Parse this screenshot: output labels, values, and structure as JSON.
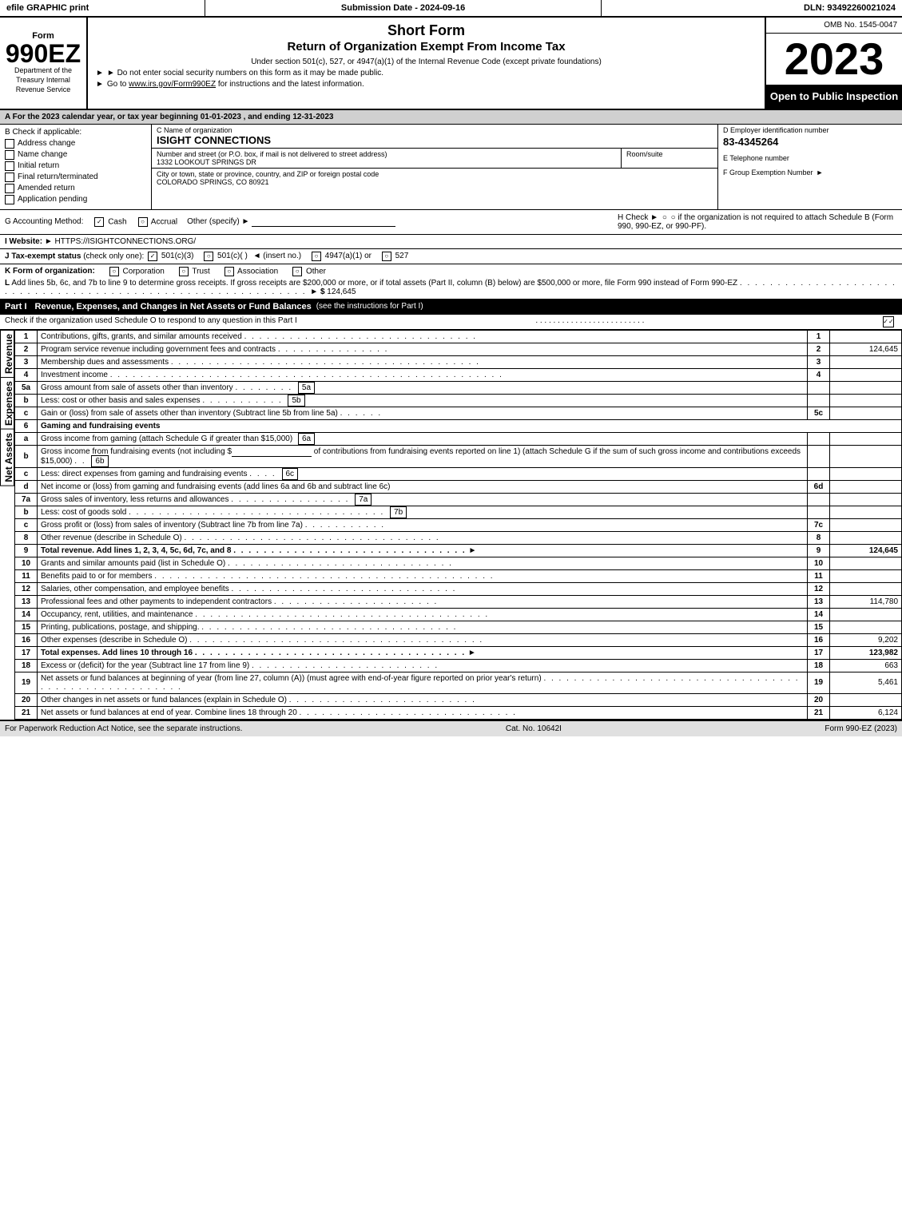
{
  "header": {
    "left": "efile GRAPHIC print",
    "mid": "Submission Date - 2024-09-16",
    "right": "DLN: 93492260021024"
  },
  "form": {
    "number": "990EZ",
    "sub": "Department of the Treasury Internal Revenue Service",
    "short_form": "Short Form",
    "return_title": "Return of Organization Exempt From Income Tax",
    "note1": "Under section 501(c), 527, or 4947(a)(1) of the Internal Revenue Code (except private foundations)",
    "note2": "► Do not enter social security numbers on this form as it may be made public.",
    "note3": "► Go to www.irs.gov/Form990EZ for instructions and the latest information.",
    "omb": "OMB No. 1545-0047",
    "year": "2023",
    "open_public": "Open to Public Inspection"
  },
  "section_a": {
    "label": "A For the 2023 calendar year, or tax year beginning 01-01-2023 , and ending 12-31-2023"
  },
  "check_applicable": {
    "label": "B Check if applicable:",
    "items": [
      {
        "label": "Address change",
        "checked": false
      },
      {
        "label": "Name change",
        "checked": false
      },
      {
        "label": "Initial return",
        "checked": false
      },
      {
        "label": "Final return/terminated",
        "checked": false
      },
      {
        "label": "Amended return",
        "checked": false
      },
      {
        "label": "Application pending",
        "checked": false
      }
    ]
  },
  "org": {
    "name_label": "C Name of organization",
    "name": "ISIGHT CONNECTIONS",
    "address_label": "Number and street (or P.O. box, if mail is not delivered to street address)",
    "address": "1332 LOOKOUT SPRINGS DR",
    "room_label": "Room/suite",
    "room": "",
    "city_label": "City or town, state or province, country, and ZIP or foreign postal code",
    "city": "COLORADO SPRINGS, CO  80921",
    "ein_label": "D Employer identification number",
    "ein": "83-4345264",
    "phone_label": "E Telephone number",
    "phone": "",
    "group_label": "F Group Exemption Number",
    "group_arrow": "►"
  },
  "accounting": {
    "label": "G Accounting Method:",
    "cash_label": "Cash",
    "cash_checked": true,
    "accrual_label": "Accrual",
    "accrual_checked": false,
    "other_label": "Other (specify) ►",
    "other_line": "___________________________",
    "h_label": "H  Check ►",
    "h_text": "○  if the organization is not required to attach Schedule B (Form 990, 990-EZ, or 990-PF)."
  },
  "website": {
    "label": "I Website: ►",
    "url": "HTTPS://ISIGHTCONNECTIONS.ORG/"
  },
  "tax_exempt": {
    "label": "J Tax-exempt status",
    "note": "(check only one):",
    "options": [
      {
        "label": "501(c)(3)",
        "checked": true
      },
      {
        "label": "501(c)(  )",
        "checked": false
      },
      {
        "label": "(insert no.)",
        "checked": false
      },
      {
        "label": "4947(a)(1) or",
        "checked": false
      },
      {
        "label": "527",
        "checked": false
      }
    ]
  },
  "k_line": {
    "label": "K Form of organization:",
    "options": [
      {
        "label": "Corporation",
        "checked": false
      },
      {
        "label": "Trust",
        "checked": false
      },
      {
        "label": "Association",
        "checked": false
      },
      {
        "label": "Other",
        "checked": false
      }
    ]
  },
  "l_line": {
    "text": "L Add lines 5b, 6c, and 7b to line 9 to determine gross receipts. If gross receipts are $200,000 or more, or if total assets (Part II, column (B) below) are $500,000 or more, file Form 990 instead of Form 990-EZ",
    "dots": ". . . . . . . . . . . . . . . . . . . . . . . . . . . . . . . . . . . . . . . . . . . . . . . . . . . .",
    "arrow": "► $",
    "amount": "124,645"
  },
  "part1": {
    "label": "Part I",
    "title": "Revenue, Expenses, and Changes in Net Assets or Fund Balances",
    "note": "(see the instructions for Part I)",
    "check_note": "Check if the organization used Schedule O to respond to any question in this Part I",
    "dots": ". . . . . . . . . . . . . . . . . . . . . . . . .",
    "checkbox": true
  },
  "revenue_rows": [
    {
      "num": "1",
      "desc": "Contributions, gifts, grants, and similar amounts received",
      "dots": ". . . . . . . . . . . . . . . . . . . . . . . . . . . .",
      "col_label": "",
      "col_num": "1",
      "amount": ""
    },
    {
      "num": "2",
      "desc": "Program service revenue including government fees and contracts",
      "dots": ". . . . . . . . . . . . . . .",
      "col_label": "",
      "col_num": "2",
      "amount": "124,645"
    },
    {
      "num": "3",
      "desc": "Membership dues and assessments",
      "dots": ". . . . . . . . . . . . . . . . . . . . . . . . . . . . . . . . . . . . . . . .",
      "col_label": "",
      "col_num": "3",
      "amount": ""
    },
    {
      "num": "4",
      "desc": "Investment income",
      "dots": ". . . . . . . . . . . . . . . . . . . . . . . . . . . . . . . . . . . . . . . . . . . . . . . . . . .",
      "col_label": "",
      "col_num": "4",
      "amount": ""
    },
    {
      "num": "5a",
      "desc": "Gross amount from sale of assets other than inventory",
      "dots": ". . . . . . . .",
      "col_label": "5a",
      "col_num": "",
      "amount": ""
    },
    {
      "num": "b",
      "desc": "Less: cost or other basis and sales expenses",
      "dots": ". . . . . . . . . . .",
      "col_label": "5b",
      "col_num": "",
      "amount": ""
    },
    {
      "num": "c",
      "desc": "Gain or (loss) from sale of assets other than inventory (Subtract line 5b from line 5a)",
      "dots": ". . . . . .",
      "col_label": "",
      "col_num": "5c",
      "amount": ""
    },
    {
      "num": "6",
      "desc": "Gaming and fundraising events",
      "dots": "",
      "col_label": "",
      "col_num": "",
      "amount": ""
    },
    {
      "num": "a",
      "desc": "Gross income from gaming (attach Schedule G if greater than $15,000)",
      "dots": "",
      "col_label": "6a",
      "col_num": "",
      "amount": ""
    },
    {
      "num": "b",
      "desc_part1": "Gross income from fundraising events (not including $",
      "underline": "________________",
      "desc_part2": " of contributions from fundraising events reported on line 1) (attach Schedule G if the sum of such gross income and contributions exceeds $15,000)",
      "dots": ". .",
      "col_label": "6b",
      "col_num": "",
      "amount": ""
    },
    {
      "num": "c",
      "desc": "Less: direct expenses from gaming and fundraising events",
      "dots": ". . . .",
      "col_label": "6c",
      "col_num": "",
      "amount": ""
    },
    {
      "num": "d",
      "desc": "Net income or (loss) from gaming and fundraising events (add lines 6a and 6b and subtract line 6c)",
      "dots": "",
      "col_label": "",
      "col_num": "6d",
      "amount": ""
    },
    {
      "num": "7a",
      "desc": "Gross sales of inventory, less returns and allowances",
      "dots": ". . . . . . . . . . . . . . . .",
      "col_label": "7a",
      "col_num": "",
      "amount": ""
    },
    {
      "num": "b",
      "desc": "Less: cost of goods sold",
      "dots": ". . . . . . . . . . . . . . . . . . . . . . . . . . . . . . . . . . .",
      "col_label": "7b",
      "col_num": "",
      "amount": ""
    },
    {
      "num": "c",
      "desc": "Gross profit or (loss) from sales of inventory (Subtract line 7b from line 7a)",
      "dots": ". . . . . . . . . . .",
      "col_label": "",
      "col_num": "7c",
      "amount": ""
    },
    {
      "num": "8",
      "desc": "Other revenue (describe in Schedule O)",
      "dots": ". . . . . . . . . . . . . . . . . . . . . . . . . . . . . . . . . .",
      "col_label": "",
      "col_num": "8",
      "amount": ""
    },
    {
      "num": "9",
      "desc": "Total revenue. Add lines 1, 2, 3, 4, 5c, 6d, 7c, and 8",
      "dots": ". . . . . . . . . . . . . . . . . . . . . . . . . . . . . . .",
      "arrow": "►",
      "col_label": "",
      "col_num": "9",
      "amount": "124,645",
      "bold": true
    }
  ],
  "expenses_rows": [
    {
      "num": "10",
      "desc": "Grants and similar amounts paid (list in Schedule O)",
      "dots": ". . . . . . . . . . . . . . . . . . . . . . . . . . . . . .",
      "col_num": "10",
      "amount": ""
    },
    {
      "num": "11",
      "desc": "Benefits paid to or for members",
      "dots": ". . . . . . . . . . . . . . . . . . . . . . . . . . . . . . . . . . . . . . . . . . . . .",
      "col_num": "11",
      "amount": ""
    },
    {
      "num": "12",
      "desc": "Salaries, other compensation, and employee benefits",
      "dots": ". . . . . . . . . . . . . . . . . . . . . . . . . . . . . .",
      "col_num": "12",
      "amount": ""
    },
    {
      "num": "13",
      "desc": "Professional fees and other payments to independent contractors",
      "dots": ". . . . . . . . . . . . . . . . . . . . . .",
      "col_num": "13",
      "amount": "114,780"
    },
    {
      "num": "14",
      "desc": "Occupancy, rent, utilities, and maintenance",
      "dots": ". . . . . . . . . . . . . . . . . . . . . . . . . . . . . . . . . . . . . . .",
      "col_num": "14",
      "amount": ""
    },
    {
      "num": "15",
      "desc": "Printing, publications, postage, and shipping.",
      "dots": ". . . . . . . . . . . . . . . . . . . . . . . . . . . . . . . . . . .",
      "col_num": "15",
      "amount": ""
    },
    {
      "num": "16",
      "desc": "Other expenses (describe in Schedule O)",
      "dots": ". . . . . . . . . . . . . . . . . . . . . . . . . . . . . . . . . . . . . . .",
      "col_num": "16",
      "amount": "9,202"
    },
    {
      "num": "17",
      "desc": "Total expenses. Add lines 10 through 16",
      "dots": ". . . . . . . . . . . . . . . . . . . . . . . . . . . . . . . . . . . .",
      "arrow": "►",
      "col_num": "17",
      "amount": "123,982",
      "bold": true
    }
  ],
  "net_assets_rows": [
    {
      "num": "18",
      "desc": "Excess or (deficit) for the year (Subtract line 17 from line 9)",
      "dots": ". . . . . . . . . . . . . . . . . . . . . . . . .",
      "col_num": "18",
      "amount": "663"
    },
    {
      "num": "19",
      "desc": "Net assets or fund balances at beginning of year (from line 27, column (A)) (must agree with end-of-year figure reported on prior year's return)",
      "dots": ". . . . . . . . . . . . . . . . . . . . . . . . . . . . . . . . . . . . . . . . . . . . . . . . . . . . .",
      "col_num": "19",
      "amount": "5,461"
    },
    {
      "num": "20",
      "desc": "Other changes in net assets or fund balances (explain in Schedule O)",
      "dots": ". . . . . . . . . . . . . . . . . . . . . . . . . .",
      "col_num": "20",
      "amount": ""
    },
    {
      "num": "21",
      "desc": "Net assets or fund balances at end of year. Combine lines 18 through 20",
      "dots": ". . . . . . . . . . . . . . . . . . . . . . . . . . . . .",
      "col_num": "21",
      "amount": "6,124"
    }
  ],
  "footer": {
    "left": "For Paperwork Reduction Act Notice, see the separate instructions.",
    "cat": "Cat. No. 10642I",
    "right": "Form 990-EZ (2023)"
  }
}
